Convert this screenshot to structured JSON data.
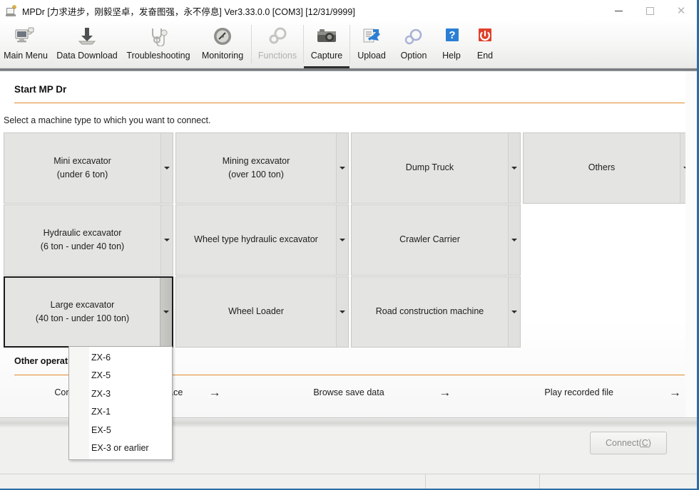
{
  "window": {
    "title": "MPDr [力求进步，刚毅坚卓，发奋图强，永不停息] Ver3.33.0.0 [COM3] [12/31/9999]",
    "icon": "app-icon",
    "minimize": "—",
    "maximize": "□",
    "close": "✕"
  },
  "toolbar": {
    "items": [
      {
        "label": "Main Menu",
        "icon": "monitor-cable-icon",
        "enabled": true,
        "active": false
      },
      {
        "label": "Data Download",
        "icon": "download-arrow-icon",
        "enabled": true,
        "active": false
      },
      {
        "label": "Troubleshooting",
        "icon": "stethoscope-icon",
        "enabled": true,
        "active": false
      },
      {
        "label": "Monitoring",
        "icon": "gauge-icon",
        "enabled": true,
        "active": false
      },
      {
        "label": "Functions",
        "icon": "gears-icon",
        "enabled": false,
        "active": false
      },
      {
        "label": "Capture",
        "icon": "camera-icon",
        "enabled": true,
        "active": true
      },
      {
        "label": "Upload",
        "icon": "upload-document-icon",
        "enabled": true,
        "active": false
      },
      {
        "label": "Option",
        "icon": "gears-outline-icon",
        "enabled": true,
        "active": false
      },
      {
        "label": "Help",
        "icon": "question-mark-icon",
        "enabled": true,
        "active": false
      },
      {
        "label": "End",
        "icon": "power-icon",
        "enabled": true,
        "active": false
      }
    ]
  },
  "page": {
    "section_title": "Start MP Dr",
    "instruction": "Select a machine type to which you want to connect."
  },
  "machines": [
    [
      {
        "line1": "Mini excavator",
        "line2": "(under 6 ton)",
        "selected": false
      },
      {
        "line1": "Mining excavator",
        "line2": "(over 100 ton)",
        "selected": false
      },
      {
        "line1": "Dump Truck",
        "line2": "",
        "selected": false
      },
      {
        "line1": "Others",
        "line2": "",
        "selected": false
      }
    ],
    [
      {
        "line1": "Hydraulic excavator",
        "line2": "(6 ton - under 40 ton)",
        "selected": false
      },
      {
        "line1": "Wheel type hydraulic excavator",
        "line2": "",
        "selected": false
      },
      {
        "line1": "Crawler Carrier",
        "line2": "",
        "selected": false
      },
      {
        "line1": "",
        "line2": "",
        "selected": false,
        "empty": true
      }
    ],
    [
      {
        "line1": "Large excavator",
        "line2": "(40 ton - under 100 ton)",
        "selected": true
      },
      {
        "line1": "Wheel Loader",
        "line2": "",
        "selected": false
      },
      {
        "line1": "Road construction machine",
        "line2": "",
        "selected": false
      },
      {
        "line1": "",
        "line2": "",
        "selected": false,
        "empty": true
      }
    ]
  ],
  "other_operations": {
    "title": "Other operations",
    "links": [
      {
        "label": "Confirm the connection interface",
        "arrow": "→"
      },
      {
        "label": "Browse save data",
        "arrow": "→"
      },
      {
        "label": "Play recorded file",
        "arrow": "→"
      }
    ]
  },
  "footer": {
    "connect_label": "Connect(",
    "connect_key": "C",
    "connect_tail": ")"
  },
  "dropdown_menu": {
    "open": true,
    "items": [
      {
        "label": "ZX-6"
      },
      {
        "label": "ZX-5"
      },
      {
        "label": "ZX-3"
      },
      {
        "label": "ZX-1"
      },
      {
        "label": "EX-5"
      },
      {
        "label": "EX-3 or earlier"
      }
    ]
  },
  "statusbar": {
    "cells": [
      "",
      "",
      ""
    ]
  },
  "colors": {
    "accent_rule": "#e08a2e",
    "window_border": "#2e6da4",
    "button_face": "#e4e4e2",
    "selected_border": "#1b1b1b"
  }
}
